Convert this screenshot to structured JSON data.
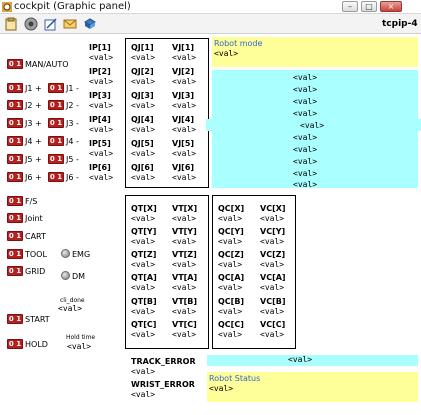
{
  "window": {
    "title": "cockpit (Graphic panel)",
    "tab": "tcpip-4"
  },
  "left_buttons": [
    {
      "badge": "0 1",
      "label": "MAN/AUTO"
    },
    {
      "badge": "0 1",
      "label": "J1 +",
      "badge2": "0 1",
      "label2": "J1 -"
    },
    {
      "badge": "0 1",
      "label": "J2 +",
      "badge2": "0 1",
      "label2": "J2 -"
    },
    {
      "badge": "0 1",
      "label": "J3 +",
      "badge2": "0 1",
      "label2": "J3 -"
    },
    {
      "badge": "0 1",
      "label": "J4 +",
      "badge2": "0 1",
      "label2": "J4 -"
    },
    {
      "badge": "0 1",
      "label": "J5 +",
      "badge2": "0 1",
      "label2": "J5 -"
    },
    {
      "badge": "0 1",
      "label": "J6 +",
      "badge2": "0 1",
      "label2": "J6 -"
    },
    {
      "badge": "0 1",
      "label": "F/S"
    },
    {
      "badge": "0 1",
      "label": "Joint"
    },
    {
      "badge": "0 1",
      "label": "CART"
    },
    {
      "badge": "0 1",
      "label": "TOOL"
    },
    {
      "badge": "0 1",
      "label": "GRID"
    },
    {
      "badge": "0 1",
      "label": "START"
    },
    {
      "badge": "0 1",
      "label": "HOLD"
    }
  ],
  "lamps": {
    "emg": "EMG",
    "dm": "DM"
  },
  "cli_done": {
    "label": "cli_done",
    "value": "<val>"
  },
  "hold_time": {
    "label": "Hold time",
    "value": "<val>"
  },
  "ip": [
    {
      "label": "IP[1]",
      "value": "<val>"
    },
    {
      "label": "IP[2]",
      "value": "<val>"
    },
    {
      "label": "IP[3]",
      "value": "<val>"
    },
    {
      "label": "IP[4]",
      "value": "<val>"
    },
    {
      "label": "IP[5]",
      "value": "<val>"
    },
    {
      "label": "IP[6]",
      "value": "<val>"
    }
  ],
  "qj": [
    {
      "label": "QJ[1]",
      "value": "<val>"
    },
    {
      "label": "QJ[2]",
      "value": "<val>"
    },
    {
      "label": "QJ[3]",
      "value": "<val>"
    },
    {
      "label": "QJ[4]",
      "value": "<val>"
    },
    {
      "label": "QJ[5]",
      "value": "<val>"
    },
    {
      "label": "QJ[6]",
      "value": "<val>"
    }
  ],
  "vj": [
    {
      "label": "VJ[1]",
      "value": "<val>"
    },
    {
      "label": "VJ[2]",
      "value": "<val>"
    },
    {
      "label": "VJ[3]",
      "value": "<val>"
    },
    {
      "label": "VJ[4]",
      "value": "<val>"
    },
    {
      "label": "VJ[5]",
      "value": "<val>"
    },
    {
      "label": "VJ[6]",
      "value": "<val>"
    }
  ],
  "qt": [
    {
      "label": "QT[X]",
      "value": "<val>"
    },
    {
      "label": "QT[Y]",
      "value": "<val>"
    },
    {
      "label": "QT[Z]",
      "value": "<val>"
    },
    {
      "label": "QT[A]",
      "value": "<val>"
    },
    {
      "label": "QT[B]",
      "value": "<val>"
    },
    {
      "label": "QT[C]",
      "value": "<val>"
    }
  ],
  "vt": [
    {
      "label": "VT[X]",
      "value": "<val>"
    },
    {
      "label": "VT[Y]",
      "value": "<val>"
    },
    {
      "label": "VT[Z]",
      "value": "<val>"
    },
    {
      "label": "VT[A]",
      "value": "<val>"
    },
    {
      "label": "VT[B]",
      "value": "<val>"
    },
    {
      "label": "VT[C]",
      "value": "<val>"
    }
  ],
  "qc": [
    {
      "label": "QC[X]",
      "value": "<val>"
    },
    {
      "label": "QC[Y]",
      "value": "<val>"
    },
    {
      "label": "QC[Z]",
      "value": "<val>"
    },
    {
      "label": "QC[A]",
      "value": "<val>"
    },
    {
      "label": "QC[B]",
      "value": "<val>"
    },
    {
      "label": "QC[C]",
      "value": "<val>"
    }
  ],
  "vc": [
    {
      "label": "VC[X]",
      "value": "<val>"
    },
    {
      "label": "VC[Y]",
      "value": "<val>"
    },
    {
      "label": "VC[Z]",
      "value": "<val>"
    },
    {
      "label": "VC[A]",
      "value": "<val>"
    },
    {
      "label": "VC[B]",
      "value": "<val>"
    },
    {
      "label": "VC[C]",
      "value": "<val>"
    }
  ],
  "robot_mode": {
    "label": "Robot mode",
    "value": "<val>"
  },
  "cyan_list": [
    "<val>",
    "<val>",
    "<val>",
    "<val>",
    "<val>",
    "<val>",
    "<val>",
    "<val>",
    "<val>",
    "<val>"
  ],
  "track_error": {
    "label": "TRACK_ERROR",
    "value": "<val>",
    "display": "<val>"
  },
  "wrist_error": {
    "label": "WRIST_ERROR",
    "value": "<val>"
  },
  "robot_status": {
    "label": "Robot Status",
    "value": "<val>"
  },
  "colors": {
    "badge": "#b52020",
    "yellow": "#ffff99",
    "cyan": "#aaffff",
    "label_blue": "#3366cc"
  }
}
